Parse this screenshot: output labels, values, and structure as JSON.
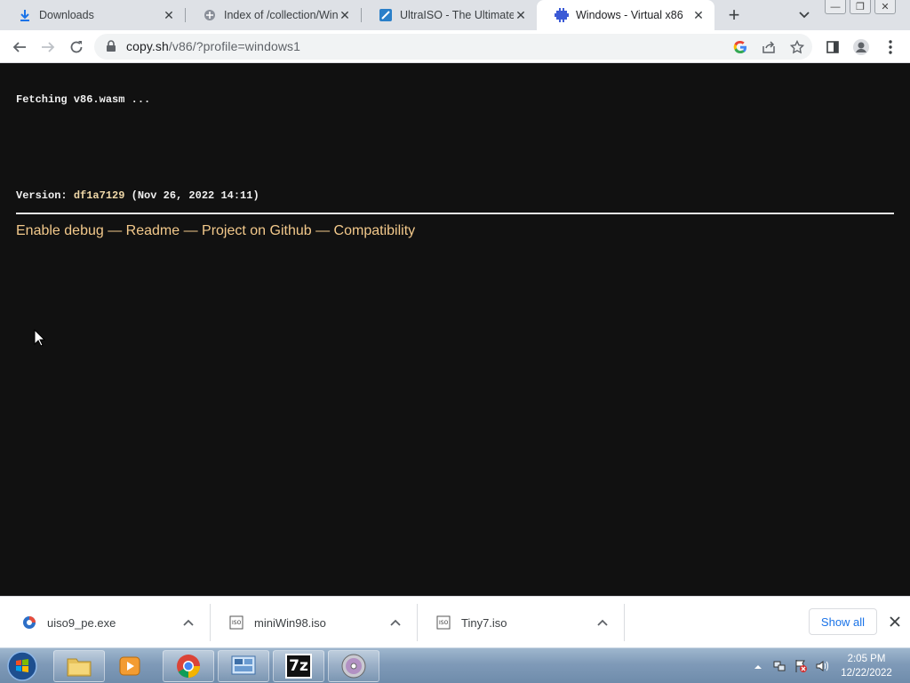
{
  "browser": {
    "tabs": [
      {
        "title": "Downloads",
        "icon": "download-icon",
        "active": false
      },
      {
        "title": "Index of /collection/Wind",
        "icon": "archive-icon",
        "active": false
      },
      {
        "title": "UltraISO - The Ultimate IS",
        "icon": "ultraiso-icon",
        "active": false
      },
      {
        "title": "Windows - Virtual x86",
        "icon": "v86-icon",
        "active": true
      }
    ],
    "url_host": "copy.sh",
    "url_path": "/v86/?profile=windows1"
  },
  "page": {
    "fetching": "Fetching v86.wasm ...",
    "version_label": "Version: ",
    "version_hash": "df1a7129",
    "version_date": " (Nov 26, 2022 14:11)",
    "links": {
      "debug": "Enable debug",
      "readme": "Readme",
      "github": "Project on Github",
      "compat": "Compatibility",
      "separator": " — "
    }
  },
  "downloads": {
    "items": [
      {
        "name": "uiso9_pe.exe",
        "icon": "installer-icon"
      },
      {
        "name": "miniWin98.iso",
        "icon": "iso-file-icon"
      },
      {
        "name": "Tiny7.iso",
        "icon": "iso-file-icon"
      }
    ],
    "show_all": "Show all"
  },
  "taskbar": {
    "apps": [
      "explorer-icon",
      "media-player-icon",
      "chrome-icon",
      "control-panel-icon",
      "7zip-icon",
      "dvd-icon"
    ],
    "seven_zip_label": "7z",
    "time": "2:05 PM",
    "date": "12/22/2022"
  }
}
